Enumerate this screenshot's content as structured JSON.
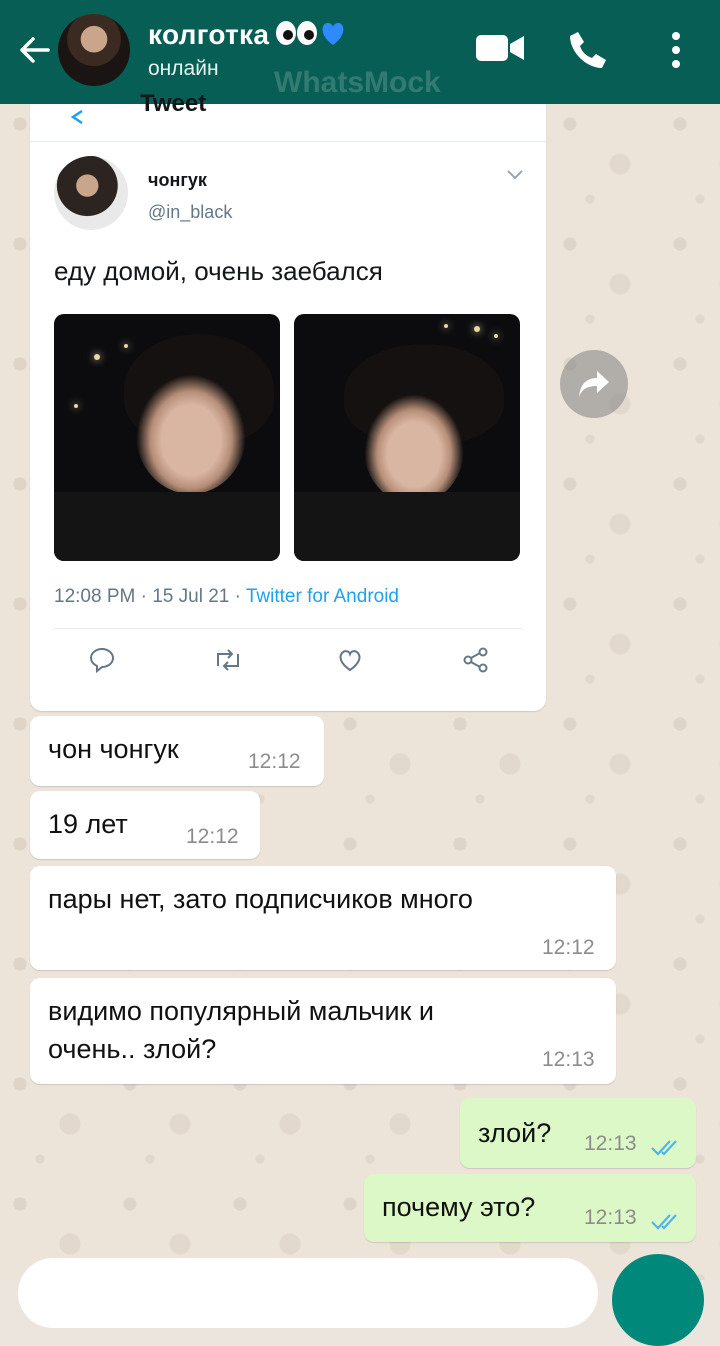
{
  "header": {
    "title": "колготка",
    "status": "онлайн",
    "watermark": "WhatsMock",
    "colors": {
      "bar": "#075E54",
      "heart": "#2E8BFF"
    }
  },
  "tweet": {
    "back_label": "Tweet",
    "name": "чонгук",
    "handle": "@in_black",
    "text": "еду домой, очень заебался",
    "meta_time": "12:08 PM · 15 Jul 21 · ",
    "meta_app": "Twitter for Android"
  },
  "messages": [
    {
      "text": "чон чонгук",
      "time": "12:12",
      "direction": "in"
    },
    {
      "text": "19 лет",
      "time": "12:12",
      "direction": "in"
    },
    {
      "text": "пары нет, зато подписчиков много",
      "time": "12:12",
      "direction": "in"
    },
    {
      "text_line1": "видимо популярный  мальчик и",
      "text_line2": "очень..  злой?",
      "time": "12:13",
      "direction": "in"
    },
    {
      "text": "злой?",
      "time": "12:13",
      "direction": "out",
      "status": "read"
    },
    {
      "text": "почему это?",
      "time": "12:13",
      "direction": "out",
      "status": "read"
    }
  ]
}
